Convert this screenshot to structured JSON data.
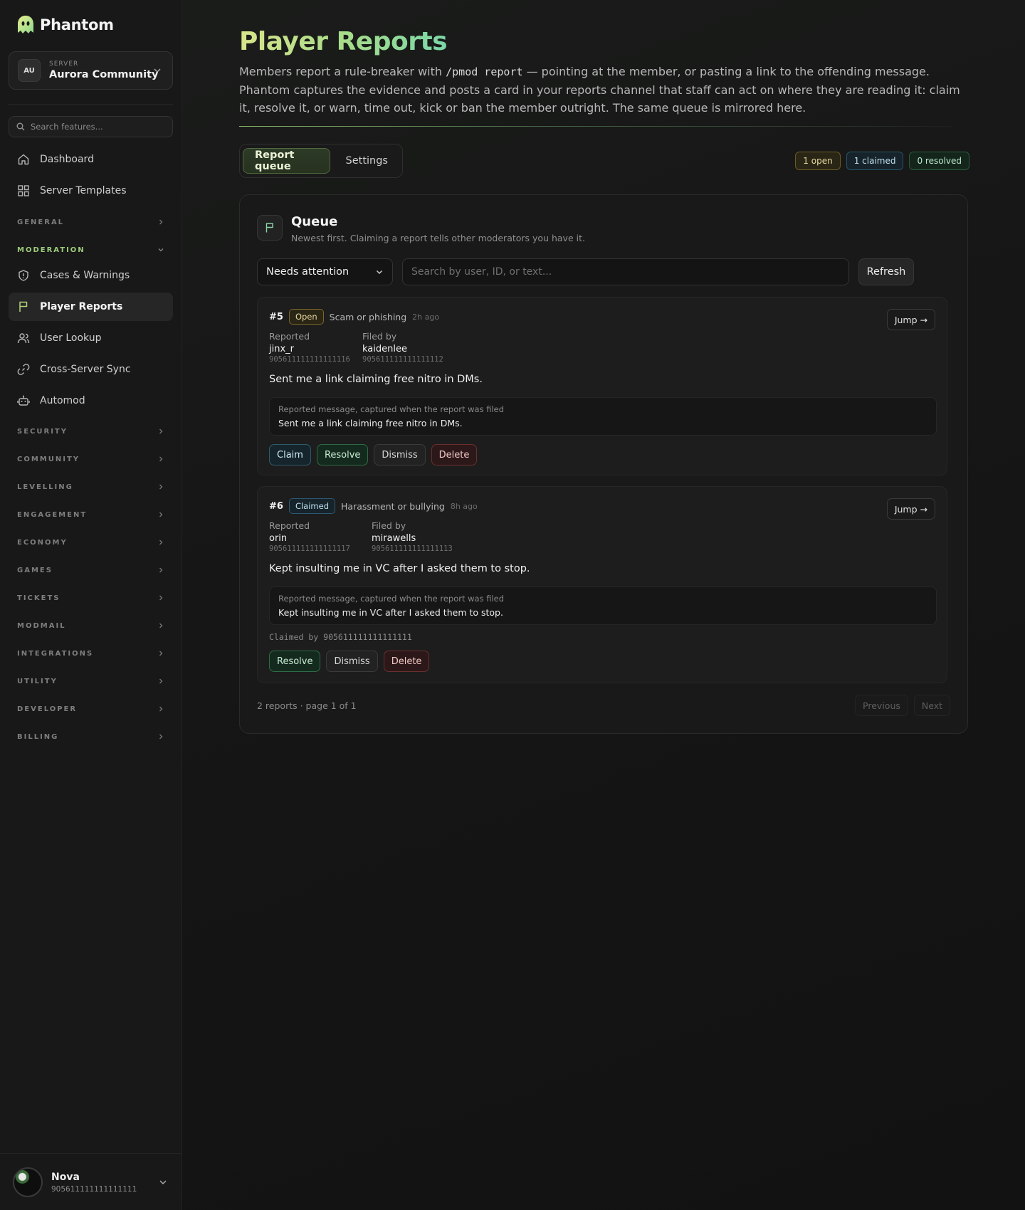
{
  "brand": {
    "name": "Phantom"
  },
  "server": {
    "eyebrow": "SERVER",
    "avatar": "AU",
    "name": "Aurora Community"
  },
  "sidebar": {
    "search_placeholder": "Search features...",
    "top_items": [
      {
        "label": "Dashboard",
        "icon": "home-icon"
      },
      {
        "label": "Server Templates",
        "icon": "grid-icon"
      }
    ],
    "sections": {
      "general": "GENERAL",
      "moderation": "MODERATION",
      "security": "SECURITY",
      "community": "COMMUNITY",
      "levelling": "LEVELLING",
      "engagement": "ENGAGEMENT",
      "economy": "ECONOMY",
      "games": "GAMES",
      "tickets": "TICKETS",
      "modmail": "MODMAIL",
      "integrations": "INTEGRATIONS",
      "utility": "UTILITY",
      "developer": "DEVELOPER",
      "billing": "BILLING"
    },
    "moderation_items": [
      {
        "label": "Cases & Warnings",
        "icon": "shield-icon"
      },
      {
        "label": "Player Reports",
        "icon": "flag-icon",
        "active": true
      },
      {
        "label": "User Lookup",
        "icon": "users-icon"
      },
      {
        "label": "Cross-Server Sync",
        "icon": "link-icon"
      },
      {
        "label": "Automod",
        "icon": "robot-icon"
      }
    ]
  },
  "user": {
    "name": "Nova",
    "id": "905611111111111111"
  },
  "page": {
    "title": "Player Reports",
    "desc_before": "Members report a rule-breaker with ",
    "desc_code": "/pmod report",
    "desc_after": " — pointing at the member, or pasting a link to the offending message. Phantom captures the evidence and posts a card in your reports channel that staff can act on where they are reading it: claim it, resolve it, or warn, time out, kick or ban the member outright. The same queue is mirrored here."
  },
  "tabs": {
    "queue": "Report queue",
    "settings": "Settings"
  },
  "counts": {
    "open": "1 open",
    "claimed": "1 claimed",
    "resolved": "0 resolved"
  },
  "queue": {
    "title": "Queue",
    "subtitle": "Newest first. Claiming a report tells other moderators you have it.",
    "filter": "Needs attention",
    "search_placeholder": "Search by user, ID, or text...",
    "refresh": "Refresh",
    "reports": [
      {
        "num": "#5",
        "status": "Open",
        "reason": "Scam or phishing",
        "time": "2h ago",
        "jump": "Jump →",
        "reported_label": "Reported",
        "reported_name": "jinx_r",
        "reported_id": "905611111111111116",
        "filed_label": "Filed by",
        "filed_name": "kaidenlee",
        "filed_id": "905611111111111112",
        "text": "Sent me a link claiming free nitro in DMs.",
        "quote_label": "Reported message, captured when the report was filed",
        "quote_text": "Sent me a link claiming free nitro in DMs.",
        "actions": {
          "claim": "Claim",
          "resolve": "Resolve",
          "dismiss": "Dismiss",
          "delete": "Delete"
        }
      },
      {
        "num": "#6",
        "status": "Claimed",
        "reason": "Harassment or bullying",
        "time": "8h ago",
        "jump": "Jump →",
        "reported_label": "Reported",
        "reported_name": "orin",
        "reported_id": "905611111111111117",
        "filed_label": "Filed by",
        "filed_name": "mirawells",
        "filed_id": "905611111111111113",
        "text": "Kept insulting me in VC after I asked them to stop.",
        "quote_label": "Reported message, captured when the report was filed",
        "quote_text": "Kept insulting me in VC after I asked them to stop.",
        "claimed_by": "Claimed by 905611111111111111",
        "actions": {
          "resolve": "Resolve",
          "dismiss": "Dismiss",
          "delete": "Delete"
        }
      }
    ],
    "pager_text": "2 reports · page 1 of 1",
    "prev": "Previous",
    "next": "Next"
  },
  "colors": {
    "accent": "#9ccc7c",
    "title_start": "#d7e48a",
    "title_end": "#7bd7a8"
  }
}
